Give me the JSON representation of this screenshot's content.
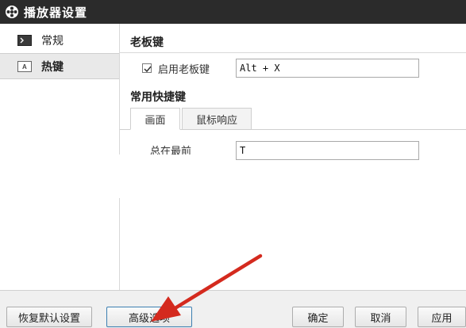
{
  "window": {
    "title": "播放器设置",
    "title_icon": "film-reel-icon"
  },
  "sidebar": {
    "items": [
      {
        "label": "常规",
        "icon": "terminal-icon",
        "active": false
      },
      {
        "label": "热键",
        "icon": "keyboard-key-icon",
        "active": true
      }
    ]
  },
  "boss_key": {
    "section_title": "老板键",
    "enable_label": "启用老板键",
    "enabled": true,
    "value": "Alt + X"
  },
  "shortcuts": {
    "section_title": "常用快捷键",
    "tabs": [
      {
        "label": "画面",
        "active": true
      },
      {
        "label": "鼠标响应",
        "active": false
      }
    ],
    "rows": [
      {
        "label": "总在最前",
        "value": "T"
      }
    ]
  },
  "buttons": {
    "restore_defaults": "恢复默认设置",
    "advanced": "高级选项",
    "ok": "确定",
    "cancel": "取消",
    "apply": "应用"
  },
  "colors": {
    "titlebar": "#2b2b2b",
    "arrow": "#d42a1e",
    "focus_border": "#3c7fb1"
  }
}
